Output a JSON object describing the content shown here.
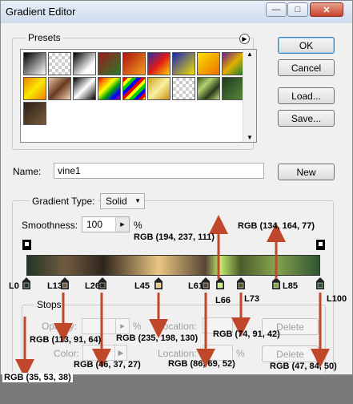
{
  "window": {
    "title": "Gradient Editor"
  },
  "presets": {
    "label": "Presets",
    "swatches": [
      {
        "css": "linear-gradient(135deg,#000,#fff)"
      },
      {
        "css": "repeating-conic-gradient(#ccc 0 25%,#fff 0 50%) 0 0/8px 8px"
      },
      {
        "css": "linear-gradient(135deg,#000,#fff 70%)"
      },
      {
        "css": "linear-gradient(135deg,#9b1c1c,#2a7a2a)"
      },
      {
        "css": "linear-gradient(135deg,#b01010,#f0a020)"
      },
      {
        "css": "linear-gradient(135deg,#2a2fa8,#e01818,#ffd200)"
      },
      {
        "css": "linear-gradient(135deg,#1a25b5,#f2e000)"
      },
      {
        "css": "linear-gradient(135deg,#f7e000,#f07000)"
      },
      {
        "css": "linear-gradient(135deg,#6a1a8a,#e0b000,#0f7a3a)"
      },
      {
        "css": "linear-gradient(135deg,#f08000,#f8e800,#f08000)"
      },
      {
        "css": "linear-gradient(135deg,#e8c4a0,#6a3a20,#f0d6b8)"
      },
      {
        "css": "linear-gradient(135deg,#000,#fff 50%,#000)"
      },
      {
        "css": "linear-gradient(135deg,#e00,#f80,#ff0,#0a0,#00f,#a0a)"
      },
      {
        "css": "repeating-linear-gradient(135deg,#e00 0 4px,#ff0 4px 8px,#0c0 8px 12px,#00f 12px 16px)"
      },
      {
        "css": "linear-gradient(135deg,#d0a020,#f8f0a0,#c89010)"
      },
      {
        "css": "repeating-conic-gradient(#ccc 0 25%,#fff 0 50%) 0 0/8px 8px"
      },
      {
        "css": "linear-gradient(135deg,#3a5a20,#b0d070,#2a3a18,#c0e080)"
      },
      {
        "css": "linear-gradient(135deg,#1e3a1e,#5a8a3a)"
      },
      {
        "css": "linear-gradient(135deg,#2a2018,#7a5a3a)"
      }
    ]
  },
  "buttons": {
    "ok": "OK",
    "cancel": "Cancel",
    "load": "Load...",
    "save": "Save...",
    "new": "New"
  },
  "name": {
    "label": "Name:",
    "value": "vine1"
  },
  "gradient_type": {
    "label": "Gradient Type:",
    "value": "Solid"
  },
  "smoothness": {
    "label": "Smoothness:",
    "value": "100",
    "unit": "%"
  },
  "stops": {
    "label": "Stops",
    "opacity_label": "Opacity:",
    "color_label": "Color:",
    "location_label": "Location:",
    "location_label2": "Location:",
    "percent": "%",
    "percent2": "%",
    "percent3": "%",
    "delete": "Delete",
    "delete2": "Delete"
  },
  "color_stops": [
    {
      "label": "L0",
      "pos": 0,
      "color": "#233526"
    },
    {
      "label": "L13",
      "pos": 13,
      "color": "#71 5b40"
    },
    {
      "label": "L26",
      "pos": 26,
      "color": "#2e251b"
    },
    {
      "label": "L45",
      "pos": 45,
      "color": "#ebc682"
    },
    {
      "label": "L61",
      "pos": 61,
      "color": "#564534"
    },
    {
      "label": "L66",
      "pos": 66,
      "color": "#c2ed6f"
    },
    {
      "label": "L73",
      "pos": 73,
      "color": "#4a5b2a"
    },
    {
      "label": "L85",
      "pos": 85,
      "color": "#86a44d"
    },
    {
      "label": "L100",
      "pos": 100,
      "color": "#2f5432"
    }
  ],
  "annotations": [
    "RGB (194, 237, 111)",
    "RGB (134, 164, 77)",
    "RGB (113, 91, 64)",
    "RGB (235, 198, 130)",
    "RGB (74, 91, 42)",
    "RGB (46, 37, 27)",
    "RGB (86, 69, 52)",
    "RGB (47, 84, 50)",
    "RGB (35, 53, 38)"
  ]
}
